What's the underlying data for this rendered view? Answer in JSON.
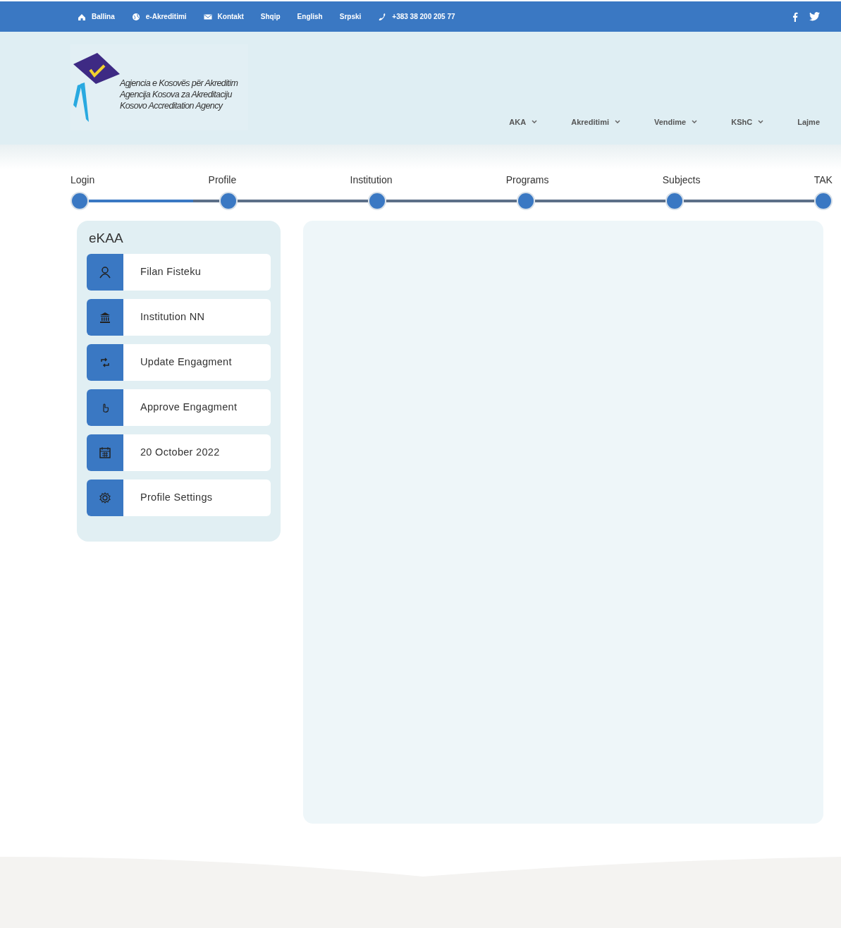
{
  "top_bar": {
    "links": [
      {
        "label": "Ballina"
      },
      {
        "label": "e-Akreditimi"
      },
      {
        "label": "Kontakt"
      },
      {
        "label": "Shqip"
      },
      {
        "label": "English"
      },
      {
        "label": "Srpski"
      },
      {
        "label": "+383 38 200 205 77"
      }
    ]
  },
  "logo": {
    "lines": [
      "Agjencia e Kosovës për Akreditim",
      "Agencija Kosova za Akreditaciju",
      "Kosovo Accreditation Agency"
    ]
  },
  "nav": [
    {
      "label": "AKA",
      "has_menu": true
    },
    {
      "label": "Akreditimi",
      "has_menu": true
    },
    {
      "label": "Vendime",
      "has_menu": true
    },
    {
      "label": "KShC",
      "has_menu": true
    },
    {
      "label": "Lajme",
      "has_menu": false
    }
  ],
  "steps": {
    "items": [
      {
        "label": "Login",
        "level": 0.8
      },
      {
        "label": "Profile"
      },
      {
        "label": "Institution"
      },
      {
        "label": "Programs"
      },
      {
        "label": "Subjects"
      },
      {
        "label": "TAK"
      }
    ]
  },
  "sidebar": {
    "title": "eKAA",
    "items": [
      {
        "label": "Filan Fisteku"
      },
      {
        "label": "Institution NN"
      },
      {
        "label": "Update Engagment"
      },
      {
        "label": "Approve Engagment"
      },
      {
        "label": "20 October  2022"
      },
      {
        "label": "Profile Settings"
      }
    ]
  }
}
